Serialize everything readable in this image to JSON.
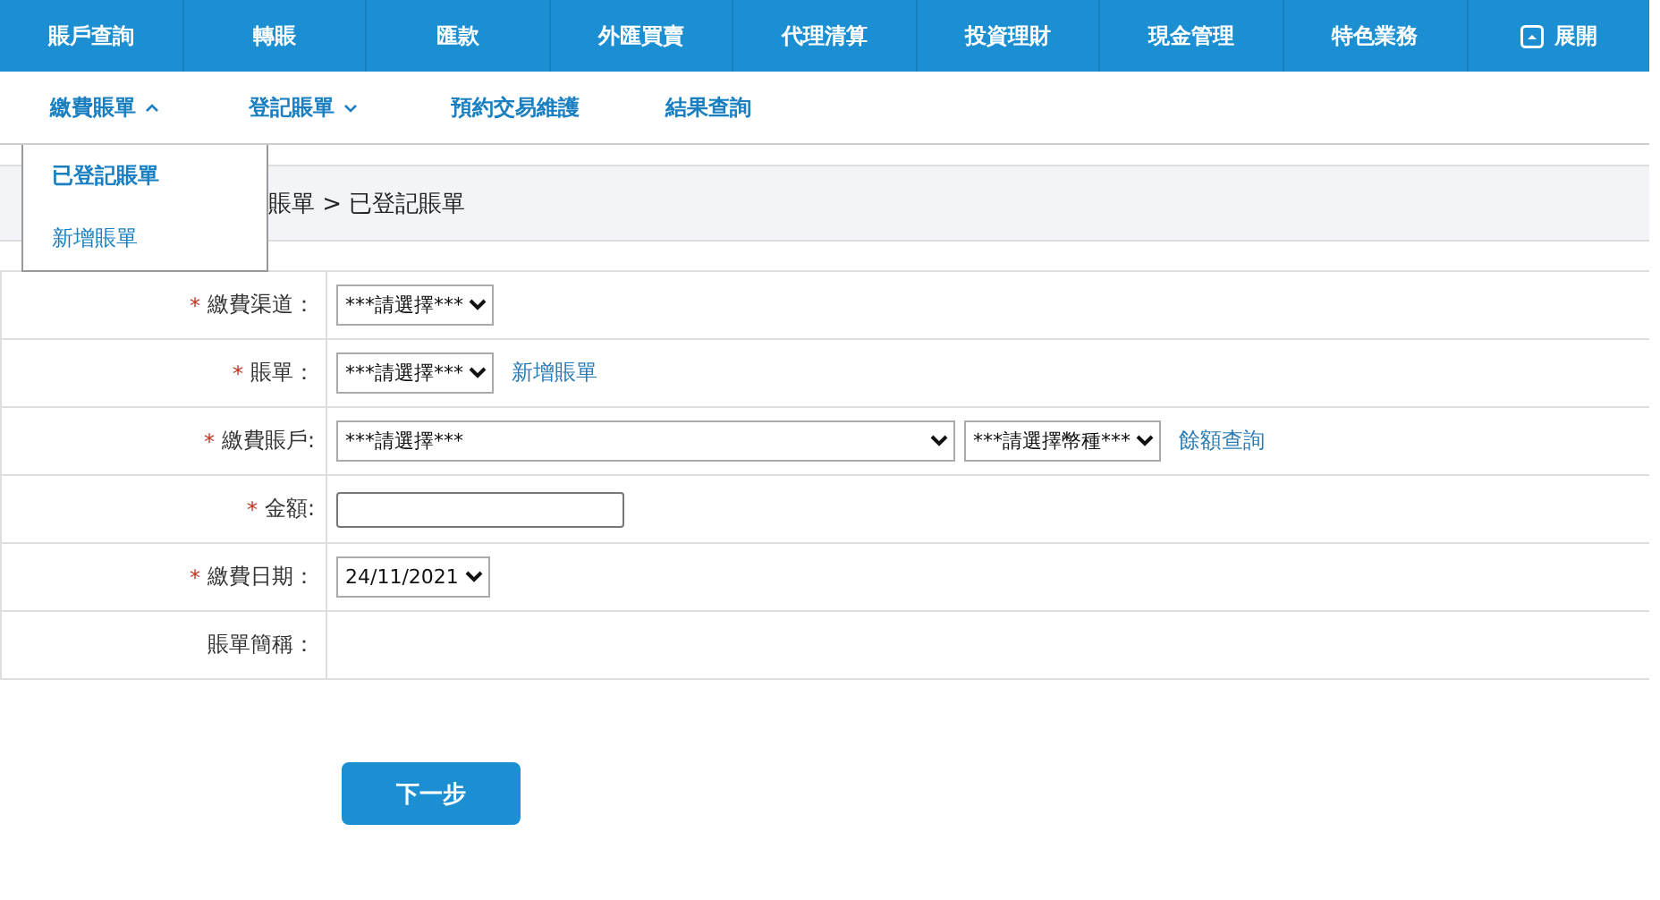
{
  "main_nav": [
    {
      "label": "賬戶查詢",
      "kind": "link"
    },
    {
      "label": "轉賬",
      "kind": "link"
    },
    {
      "label": "匯款",
      "kind": "link"
    },
    {
      "label": "外匯買賣",
      "kind": "link"
    },
    {
      "label": "代理清算",
      "kind": "link"
    },
    {
      "label": "投資理財",
      "kind": "link"
    },
    {
      "label": "現金管理",
      "kind": "link"
    },
    {
      "label": "特色業務",
      "kind": "link"
    },
    {
      "label": "展開",
      "kind": "toggle"
    }
  ],
  "sub_nav": [
    {
      "label": "繳費賬單",
      "kind": "dropdown",
      "expanded": true
    },
    {
      "label": "登記賬單",
      "kind": "dropdown",
      "expanded": false
    },
    {
      "label": "預約交易維護",
      "kind": "link"
    },
    {
      "label": "結果查詢",
      "kind": "link"
    }
  ],
  "dropdown_menu": [
    {
      "label": "已登記賬單",
      "selected": true
    },
    {
      "label": "新增賬單",
      "selected": false
    }
  ],
  "breadcrumb": "賬單 > 已登記賬單",
  "form": [
    {
      "mark": "*",
      "label": "繳費渠道：",
      "controls": [
        {
          "kind": "select",
          "value": "***請選擇***"
        }
      ]
    },
    {
      "mark": "*",
      "label": "賬單：",
      "controls": [
        {
          "kind": "select",
          "value": "***請選擇***"
        },
        {
          "kind": "link",
          "value": "新增賬單"
        }
      ]
    },
    {
      "mark": "*",
      "label": "繳費賬戶:",
      "controls": [
        {
          "kind": "wide-select",
          "value": "***請選擇***"
        },
        {
          "kind": "select",
          "value": "***請選擇幣種***"
        },
        {
          "kind": "link",
          "value": "餘額查詢"
        }
      ]
    },
    {
      "mark": "*",
      "label": "金額:",
      "controls": [
        {
          "kind": "input"
        }
      ]
    },
    {
      "mark": "*",
      "label": "繳費日期：",
      "controls": [
        {
          "kind": "select",
          "value": "24/11/2021"
        }
      ]
    },
    {
      "label": "賬單簡稱："
    }
  ],
  "next_button": "下一步"
}
